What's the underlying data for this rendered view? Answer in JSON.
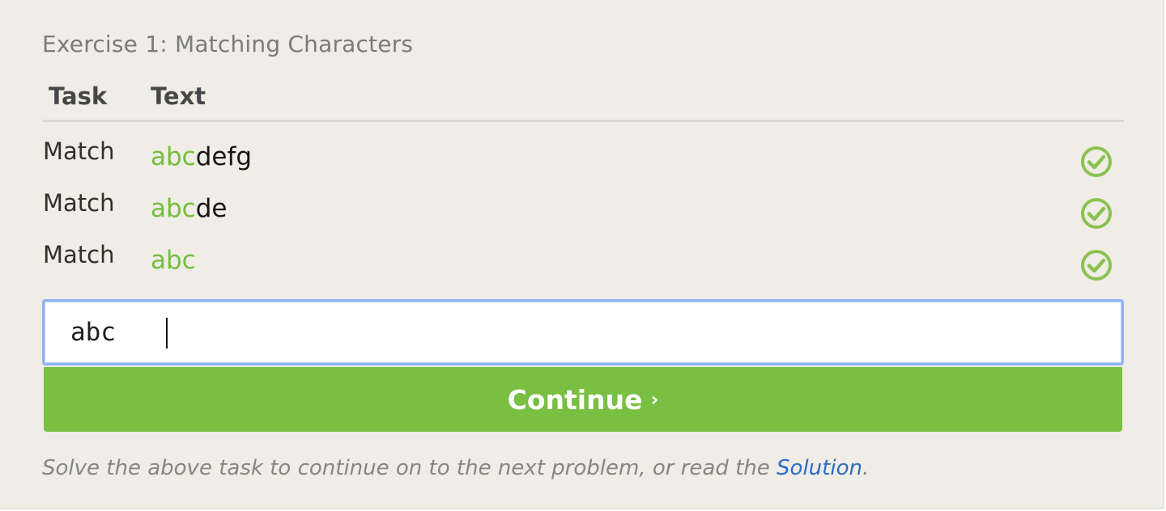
{
  "exercise": {
    "title": "Exercise 1: Matching Characters"
  },
  "table": {
    "headers": [
      "Task",
      "Text"
    ],
    "rows": [
      {
        "task": "Match",
        "matched": "abc",
        "rest": "defg",
        "status": "check-circle-icon"
      },
      {
        "task": "Match",
        "matched": "abc",
        "rest": "de",
        "status": "check-circle-icon"
      },
      {
        "task": "Match",
        "matched": "abc",
        "rest": "",
        "status": "check-circle-icon"
      }
    ]
  },
  "input": {
    "value": "abc"
  },
  "continue_button": {
    "label": "Continue",
    "chevron": "›"
  },
  "help": {
    "text": "Solve the above task to continue on to the next problem, or read the ",
    "link_text": "Solution",
    "suffix": "."
  },
  "colors": {
    "match_green": "#76bc3e",
    "button_green": "#78bf42",
    "link_blue": "#2a6cc8",
    "panel_bg": "#efede6"
  }
}
